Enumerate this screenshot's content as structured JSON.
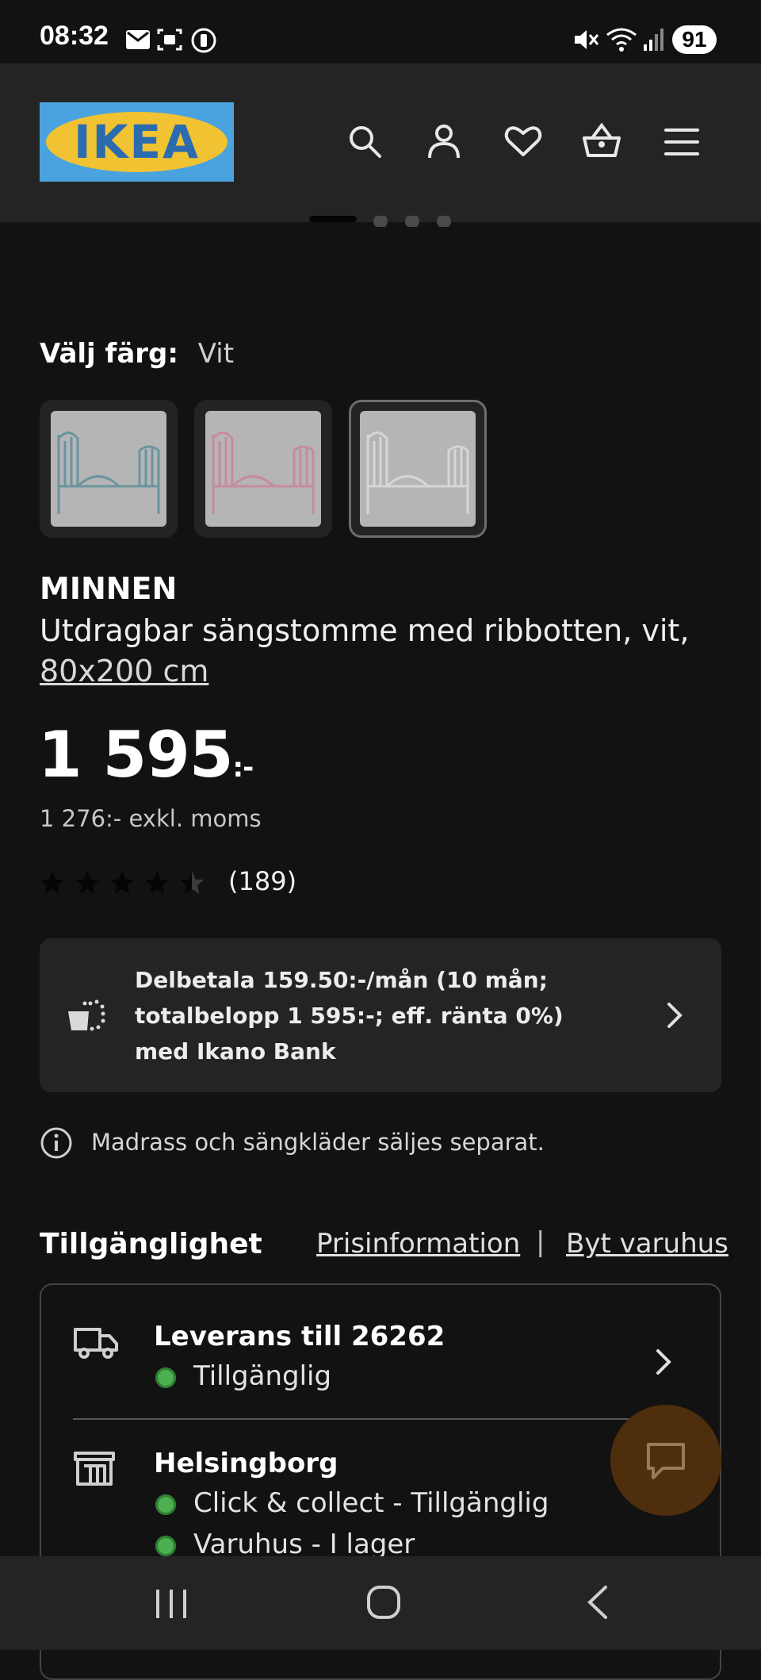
{
  "status_bar": {
    "time": "08:32",
    "battery": "91"
  },
  "header": {
    "logo_text": "IKEA"
  },
  "color_picker": {
    "label": "Välj färg:",
    "selected": "Vit",
    "options": [
      "blue",
      "pink",
      "white"
    ]
  },
  "product": {
    "name": "MINNEN",
    "description": "Utdragbar sängstomme med ribbotten, vit,",
    "size": "80x200 cm",
    "price": "1 595",
    "price_suffix": ":-",
    "price_ex_vat": "1 276:- exkl. moms",
    "rating_stars": 4.5,
    "review_count": "(189)"
  },
  "finance": {
    "text": "Delbetala 159.50:-/mån (10 mån; totalbelopp 1 595:-; eff. ränta 0%) med Ikano Bank"
  },
  "info": {
    "text": "Madrass och sängkläder säljes separat."
  },
  "availability": {
    "title": "Tillgänglighet",
    "price_info_link": "Prisinformation",
    "separator": "|",
    "change_store_link": "Byt varuhus",
    "delivery": {
      "title": "Leverans till 26262",
      "status": "Tillgänglig"
    },
    "store": {
      "title": "Helsingborg",
      "status1": "Click & collect - Tillgänglig",
      "status2": "Varuhus - I lager"
    }
  },
  "colors": {
    "background": "#121212",
    "header": "#242424",
    "available": "#4caf50",
    "chat": "#4e2e0d"
  }
}
